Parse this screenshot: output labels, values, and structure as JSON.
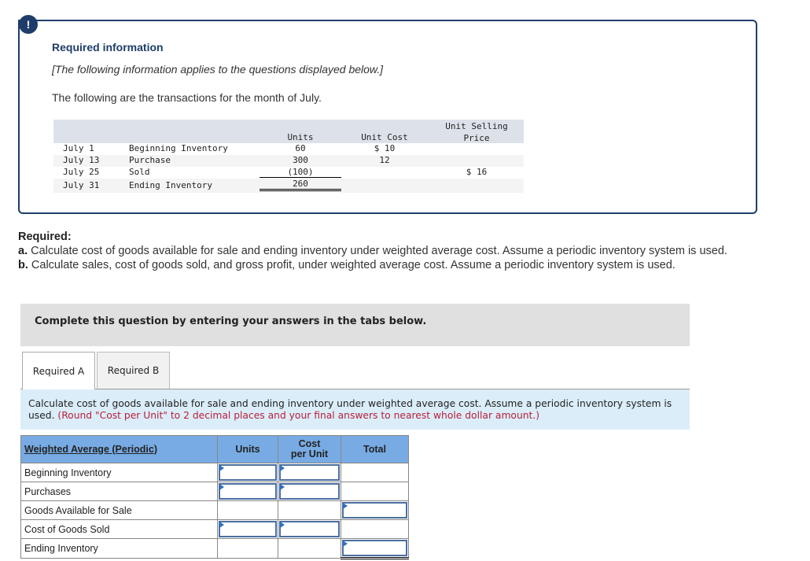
{
  "info": {
    "badge_icon": "!",
    "title": "Required information",
    "note": "[The following information applies to the questions displayed below.]",
    "intro": "The following are the transactions for the month of July."
  },
  "transactions": {
    "headers": {
      "units": "Units",
      "unit_cost": "Unit Cost",
      "unit_selling_price": "Unit Selling\nPrice"
    },
    "rows": [
      {
        "date": "July 1",
        "description": "Beginning Inventory",
        "units": "60",
        "unit_cost": "$ 10",
        "unit_selling_price": ""
      },
      {
        "date": "July 13",
        "description": "Purchase",
        "units": "300",
        "unit_cost": "12",
        "unit_selling_price": ""
      },
      {
        "date": "July 25",
        "description": "Sold",
        "units": "(100)",
        "unit_cost": "",
        "unit_selling_price": "$ 16"
      },
      {
        "date": "July 31",
        "description": "Ending Inventory",
        "units": "260",
        "unit_cost": "",
        "unit_selling_price": ""
      }
    ]
  },
  "required": {
    "heading": "Required:",
    "a_label": "a.",
    "a_text": " Calculate cost of goods available for sale and ending inventory under weighted average cost. Assume a periodic inventory system is used.",
    "b_label": "b.",
    "b_text": " Calculate sales, cost of goods sold, and gross profit, under weighted average cost. Assume a periodic inventory system is used."
  },
  "complete_bar": "Complete this question by entering your answers in the tabs below.",
  "tabs": [
    {
      "label": "Required A",
      "active": true
    },
    {
      "label": "Required B",
      "active": false
    }
  ],
  "instructions": {
    "text": "Calculate cost of goods available for sale and ending inventory under weighted average cost. Assume a periodic inventory system is used. ",
    "hint": "(Round \"Cost per Unit\" to 2 decimal places and your final answers to nearest whole dollar amount.)"
  },
  "answer_table": {
    "headers": {
      "label": "Weighted Average (Periodic)",
      "units": "Units",
      "cost_per_unit": "Cost per Unit",
      "total": "Total"
    },
    "rows": [
      {
        "label": "Beginning Inventory",
        "units": "",
        "cost_per_unit": "",
        "total": ""
      },
      {
        "label": "Purchases",
        "units": "",
        "cost_per_unit": "",
        "total": ""
      },
      {
        "label": "Goods Available for Sale",
        "units": "",
        "cost_per_unit": "",
        "total": ""
      },
      {
        "label": "Cost of Goods Sold",
        "units": "",
        "cost_per_unit": "",
        "total": ""
      },
      {
        "label": "Ending Inventory",
        "units": "",
        "cost_per_unit": "",
        "total": ""
      }
    ]
  },
  "colors": {
    "brand_navy": "#1e3d6b",
    "table_header_blue": "#78abe3",
    "instruction_bg": "#dbedf9",
    "hint_red": "#b8203b",
    "complete_bar_bg": "#e0e0e0"
  }
}
